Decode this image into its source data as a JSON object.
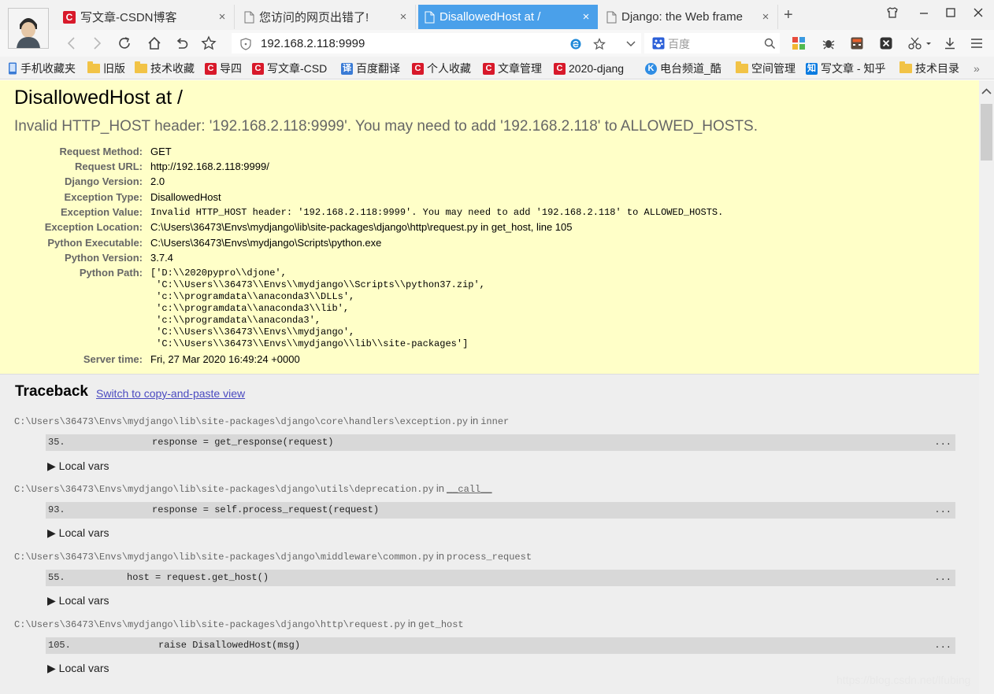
{
  "browser": {
    "tabs": [
      {
        "title": "写文章-CSDN博客",
        "icon": "csdn-icon",
        "active": false
      },
      {
        "title": "您访问的网页出错了!",
        "icon": "page-icon",
        "active": false
      },
      {
        "title": "DisallowedHost at /",
        "icon": "page-icon",
        "active": true
      },
      {
        "title": "Django: the Web frame",
        "icon": "page-icon",
        "active": false
      }
    ],
    "close_glyph": "×",
    "new_tab_glyph": "+",
    "url": "192.168.2.118:9999",
    "search_placeholder": "百度",
    "accent_color": "#4aa0ea"
  },
  "bookmarks": [
    {
      "label": "手机收藏夹",
      "icon": "phone-icon"
    },
    {
      "label": "旧版",
      "icon": "folder-icon"
    },
    {
      "label": "技术收藏",
      "icon": "folder-icon"
    },
    {
      "label": "导四",
      "icon": "csdn-icon"
    },
    {
      "label": "写文章-CSD",
      "icon": "csdn-icon"
    },
    {
      "label": "百度翻译",
      "icon": "translate-icon"
    },
    {
      "label": "个人收藏",
      "icon": "csdn-icon"
    },
    {
      "label": "文章管理",
      "icon": "csdn-icon"
    },
    {
      "label": "2020-djang",
      "icon": "csdn-icon"
    },
    {
      "label": "电台频道_酷",
      "icon": "radio-icon"
    },
    {
      "label": "空间管理",
      "icon": "folder-icon"
    },
    {
      "label": "写文章 - 知乎",
      "icon": "zhihu-icon"
    },
    {
      "label": "技术目录",
      "icon": "folder-icon"
    }
  ],
  "bookmarks_overflow": "»",
  "error": {
    "title": "DisallowedHost at /",
    "message": "Invalid HTTP_HOST header: '192.168.2.118:9999'. You may need to add '192.168.2.118' to ALLOWED_HOSTS.",
    "meta": [
      {
        "key": "Request Method:",
        "value": "GET"
      },
      {
        "key": "Request URL:",
        "value": "http://192.168.2.118:9999/"
      },
      {
        "key": "Django Version:",
        "value": "2.0"
      },
      {
        "key": "Exception Type:",
        "value": "DisallowedHost"
      },
      {
        "key": "Exception Value:",
        "value": "Invalid HTTP_HOST header: '192.168.2.118:9999'. You may need to add '192.168.2.118' to ALLOWED_HOSTS."
      },
      {
        "key": "Exception Location:",
        "value": "C:\\Users\\36473\\Envs\\mydjango\\lib\\site-packages\\django\\http\\request.py in get_host, line 105"
      },
      {
        "key": "Python Executable:",
        "value": "C:\\Users\\36473\\Envs\\mydjango\\Scripts\\python.exe"
      },
      {
        "key": "Python Version:",
        "value": "3.7.4"
      },
      {
        "key": "Python Path:",
        "value": "['D:\\\\2020pypro\\\\djone',\n 'C:\\\\Users\\\\36473\\\\Envs\\\\mydjango\\\\Scripts\\\\python37.zip',\n 'c:\\\\programdata\\\\anaconda3\\\\DLLs',\n 'c:\\\\programdata\\\\anaconda3\\\\lib',\n 'c:\\\\programdata\\\\anaconda3',\n 'C:\\\\Users\\\\36473\\\\Envs\\\\mydjango',\n 'C:\\\\Users\\\\36473\\\\Envs\\\\mydjango\\\\lib\\\\site-packages']"
      },
      {
        "key": "Server time:",
        "value": "Fri, 27 Mar 2020 16:49:24 +0000"
      }
    ]
  },
  "traceback": {
    "title": "Traceback",
    "switch_link": "Switch to copy-and-paste view",
    "in_word": "in",
    "local_vars_label": "Local vars",
    "ellipsis": "...",
    "frames": [
      {
        "file": "C:\\Users\\36473\\Envs\\mydjango\\lib\\site-packages\\django\\core\\handlers\\exception.py",
        "func": "inner",
        "lineno": "35.",
        "code": "response = get_response(request)"
      },
      {
        "file": "C:\\Users\\36473\\Envs\\mydjango\\lib\\site-packages\\django\\utils\\deprecation.py",
        "func": "__call__",
        "lineno": "93.",
        "code": "response = self.process_request(request)"
      },
      {
        "file": "C:\\Users\\36473\\Envs\\mydjango\\lib\\site-packages\\django\\middleware\\common.py",
        "func": "process_request",
        "lineno": "55.",
        "code": "host = request.get_host()"
      },
      {
        "file": "C:\\Users\\36473\\Envs\\mydjango\\lib\\site-packages\\django\\http\\request.py",
        "func": "get_host",
        "lineno": "105.",
        "code": "raise DisallowedHost(msg)"
      }
    ]
  },
  "watermark": "https://blog.csdn.net/lfubing"
}
